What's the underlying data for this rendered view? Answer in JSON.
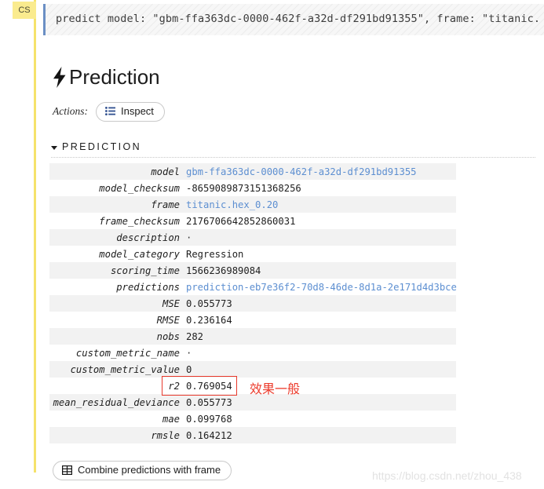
{
  "annotation_flag": {
    "label": "CS"
  },
  "code_block": {
    "text": "predict model: \"gbm-ffa363dc-0000-462f-a32d-df291bd91355\", frame: \"titanic."
  },
  "header": {
    "title": "Prediction",
    "icon": "lightning-bolt-icon"
  },
  "actions": {
    "label": "Actions:",
    "inspect_button": {
      "label": "Inspect",
      "icon": "list-icon"
    }
  },
  "section": {
    "title": "PREDICTION",
    "caret": "caret-down-icon",
    "expanded": true
  },
  "table": {
    "rows": [
      {
        "key": "model",
        "value": "gbm-ffa363dc-0000-462f-a32d-df291bd91355",
        "kind": "link"
      },
      {
        "key": "model_checksum",
        "value": "-8659089873151368256",
        "kind": "text"
      },
      {
        "key": "frame",
        "value": "titanic.hex_0.20",
        "kind": "link"
      },
      {
        "key": "frame_checksum",
        "value": "2176706642852860031",
        "kind": "text"
      },
      {
        "key": "description",
        "value": "·",
        "kind": "dot"
      },
      {
        "key": "model_category",
        "value": "Regression",
        "kind": "text"
      },
      {
        "key": "scoring_time",
        "value": "1566236989084",
        "kind": "text"
      },
      {
        "key": "predictions",
        "value": "prediction-eb7e36f2-70d8-46de-8d1a-2e171d4d3bce",
        "kind": "link"
      },
      {
        "key": "MSE",
        "value": "0.055773",
        "kind": "text"
      },
      {
        "key": "RMSE",
        "value": "0.236164",
        "kind": "text"
      },
      {
        "key": "nobs",
        "value": "282",
        "kind": "text"
      },
      {
        "key": "custom_metric_name",
        "value": "·",
        "kind": "dot"
      },
      {
        "key": "custom_metric_value",
        "value": "0",
        "kind": "text"
      },
      {
        "key": "r2",
        "value": "0.769054",
        "kind": "text"
      },
      {
        "key": "mean_residual_deviance",
        "value": "0.055773",
        "kind": "text"
      },
      {
        "key": "mae",
        "value": "0.099768",
        "kind": "text"
      },
      {
        "key": "rmsle",
        "value": "0.164212",
        "kind": "text"
      }
    ]
  },
  "annotation": {
    "text": "效果一般",
    "color": "#ec3b2c",
    "highlight_row_key": "r2"
  },
  "footer": {
    "combine_button": {
      "label": "Combine predictions with frame",
      "icon": "table-grid-icon"
    }
  },
  "watermark": {
    "text": "https://blog.csdn.net/zhou_438"
  },
  "colors": {
    "link": "#5d8fd1",
    "annotation_red": "#ec3b2c",
    "rail_yellow": "#f5e26b",
    "flag_yellow": "#faeb8e",
    "code_bar_blue": "#6b8fc4",
    "row_stripe": "#f2f2f2"
  }
}
